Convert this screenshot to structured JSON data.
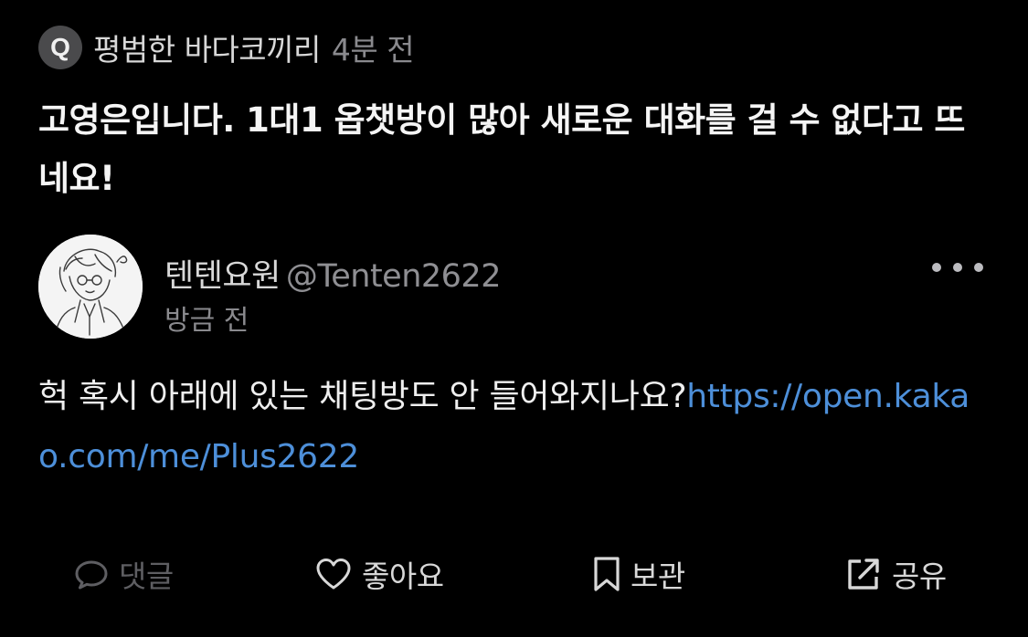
{
  "question": {
    "badge": "Q",
    "author": "평범한 바다코끼리",
    "time": "4분 전",
    "text": "고영은입니다. 1대1 옵챗방이 많아 새로운 대화를 걸 수 없다고 뜨네요!"
  },
  "reply": {
    "author_name": "텐텐요원",
    "handle": "@Tenten2622",
    "time": "방금 전",
    "text": "헉 혹시 아래에 있는 채팅방도 안 들어와지나요?",
    "link": "https://open.kakao.com/me/Plus2622",
    "more_icon": "more-horizontal-icon"
  },
  "actions": {
    "comment": {
      "label": "댓글",
      "icon": "comment-icon"
    },
    "like": {
      "label": "좋아요",
      "icon": "heart-icon"
    },
    "save": {
      "label": "보관",
      "icon": "bookmark-icon"
    },
    "share": {
      "label": "공유",
      "icon": "share-icon"
    }
  },
  "colors": {
    "background": "#000000",
    "link": "#4d8fd9",
    "muted": "#8a8a8e",
    "disabled": "#5e5e62"
  }
}
